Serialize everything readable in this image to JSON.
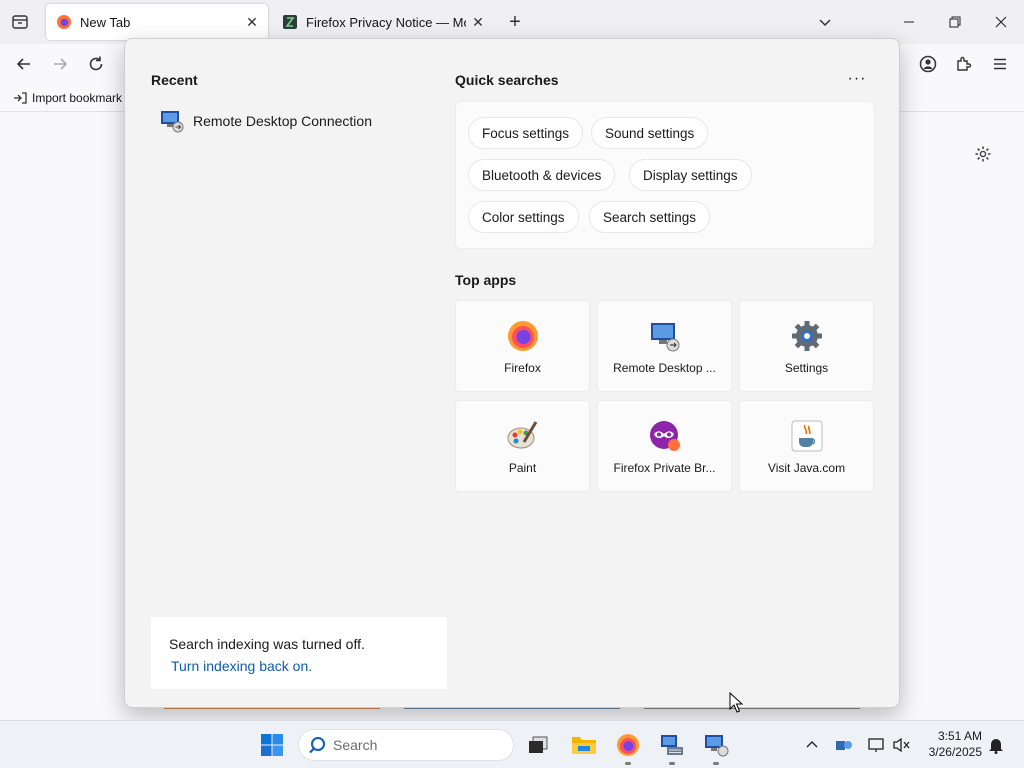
{
  "browser": {
    "tabs": [
      {
        "title": "New Tab",
        "active": true,
        "favicon": "firefox-icon"
      },
      {
        "title": "Firefox Privacy Notice — Mozill",
        "active": false,
        "favicon": "mozilla-icon"
      }
    ],
    "tab_close_glyph": "✕",
    "new_tab_glyph": "+",
    "bookmarks_toolbar": {
      "import_label": "Import bookmark"
    }
  },
  "start_menu": {
    "recent": {
      "title": "Recent",
      "items": [
        {
          "label": "Remote Desktop Connection",
          "icon": "remote-desktop-icon"
        }
      ]
    },
    "quick_searches": {
      "title": "Quick searches",
      "more_glyph": "···",
      "chips": [
        "Focus settings",
        "Sound settings",
        "Bluetooth & devices",
        "Display settings",
        "Color settings",
        "Search settings"
      ]
    },
    "top_apps": {
      "title": "Top apps",
      "apps": [
        {
          "label": "Firefox",
          "icon": "firefox-icon"
        },
        {
          "label": "Remote Desktop ...",
          "icon": "remote-desktop-icon"
        },
        {
          "label": "Settings",
          "icon": "settings-gear-icon"
        },
        {
          "label": "Paint",
          "icon": "paint-icon"
        },
        {
          "label": "Firefox Private Br...",
          "icon": "firefox-private-icon"
        },
        {
          "label": "Visit Java.com",
          "icon": "java-icon"
        }
      ]
    },
    "indexing": {
      "message": "Search indexing was turned off.",
      "link": "Turn indexing back on."
    }
  },
  "taskbar": {
    "search_placeholder": "Search",
    "pinned": [
      "start-icon",
      "task-view-icon",
      "file-explorer-icon",
      "firefox-icon",
      "network-app-icon",
      "remote-desktop-icon"
    ],
    "clock": {
      "time": "3:51 AM",
      "date": "3/26/2025"
    }
  },
  "colors": {
    "accent_link": "#0b5cad",
    "panel_bg": "#f3f3f3",
    "chrome_bg": "#f0f0f4"
  }
}
